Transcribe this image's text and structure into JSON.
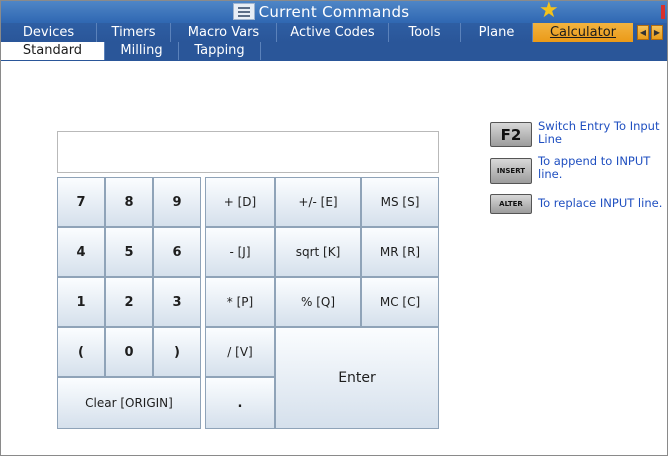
{
  "window": {
    "title": "Current Commands"
  },
  "tabs_primary": [
    {
      "label": "Devices"
    },
    {
      "label": "Timers"
    },
    {
      "label": "Macro Vars"
    },
    {
      "label": "Active Codes"
    },
    {
      "label": "Tools"
    },
    {
      "label": "Plane"
    },
    {
      "label": "Calculator",
      "active": true
    }
  ],
  "tabs_secondary": [
    {
      "label": "Standard",
      "active": true
    },
    {
      "label": "Milling"
    },
    {
      "label": "Tapping"
    }
  ],
  "calculator": {
    "display_value": "",
    "keys": {
      "k7": "7",
      "k8": "8",
      "k9": "9",
      "k4": "4",
      "k5": "5",
      "k6": "6",
      "k1": "1",
      "k2": "2",
      "k3": "3",
      "lparen": "(",
      "k0": "0",
      "rparen": ")",
      "plus": "+ [D]",
      "plusminus": "+/- [E]",
      "ms": "MS [S]",
      "minus": "- [J]",
      "sqrt": "sqrt [K]",
      "mr": "MR [R]",
      "multiply": "* [P]",
      "percent": "% [Q]",
      "mc": "MC [C]",
      "divide": "/ [V]",
      "dot": ".",
      "clear": "Clear [ORIGIN]",
      "enter": "Enter"
    }
  },
  "legend": [
    {
      "key": "F2",
      "text": "Switch Entry To Input Line"
    },
    {
      "key": "INSERT",
      "text": "To append to INPUT line."
    },
    {
      "key": "ALTER",
      "text": "To replace INPUT line."
    }
  ],
  "colors": {
    "title_bar": "#2f67b2",
    "active_tab": "#eb9a18",
    "legend_text": "#1f4fc0"
  }
}
